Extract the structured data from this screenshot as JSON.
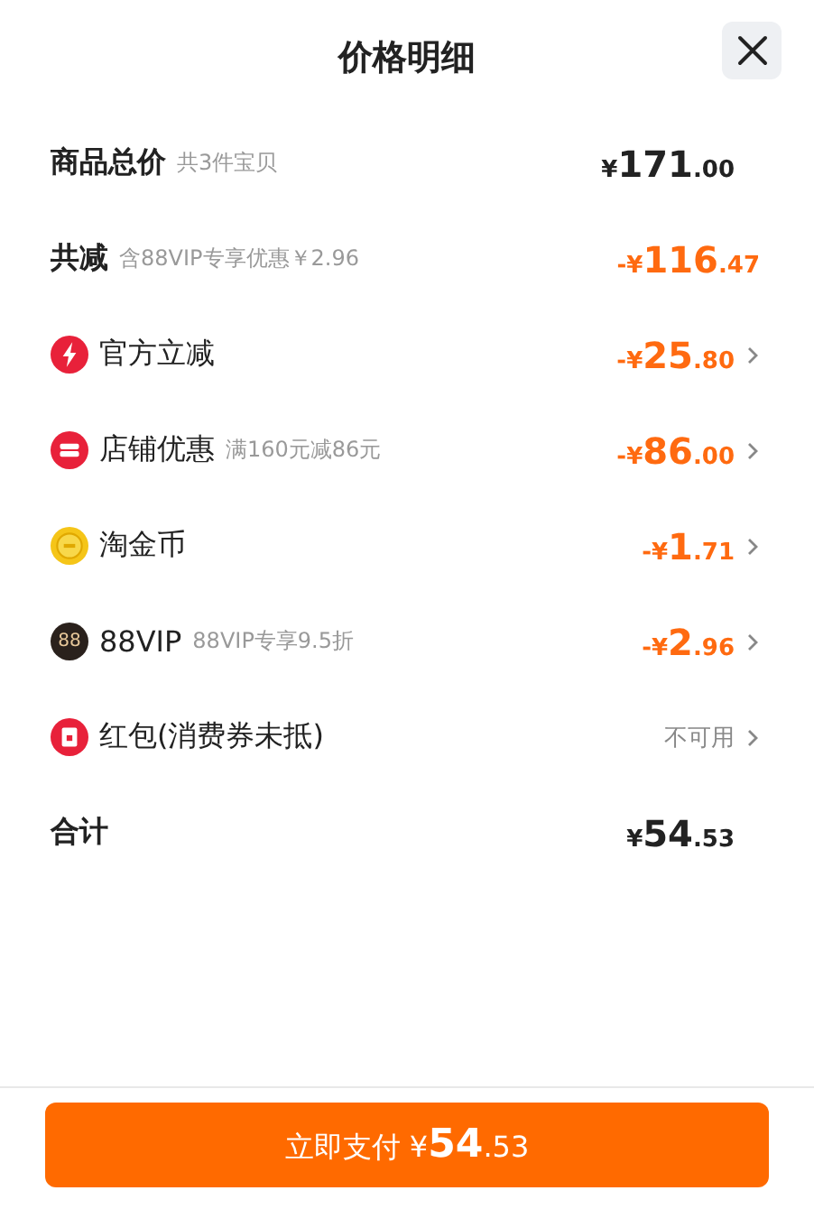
{
  "title": "价格明细",
  "rows": [
    {
      "kind": "total",
      "label": "商品总价",
      "note": "共3件宝贝",
      "amount": {
        "sign": "¥",
        "int": "171",
        "dec": ".00"
      }
    },
    {
      "kind": "discount_total",
      "label": "共减",
      "note": "含88VIP专享优惠￥2.96",
      "amount": {
        "sign": "-¥",
        "int": "116",
        "dec": ".47"
      }
    },
    {
      "kind": "promo",
      "label": "官方立减",
      "amount": {
        "sign": "-¥",
        "int": "25",
        "dec": ".80"
      }
    },
    {
      "kind": "promo",
      "label": "店铺优惠",
      "note": "满160元减86元",
      "amount": {
        "sign": "-¥",
        "int": "86",
        "dec": ".00"
      }
    },
    {
      "kind": "promo",
      "label": "淘金币",
      "amount": {
        "sign": "-¥",
        "int": "1",
        "dec": ".71"
      }
    },
    {
      "kind": "promo",
      "label": "88VIP",
      "icon_text": "88",
      "note": "88VIP专享9.5折",
      "amount": {
        "sign": "-¥",
        "int": "2",
        "dec": ".96"
      }
    },
    {
      "kind": "promo",
      "label": "红包(消费券未抵)",
      "status": "不可用"
    },
    {
      "kind": "total",
      "label": "合计",
      "amount": {
        "sign": "¥",
        "int": "54",
        "dec": ".53"
      }
    }
  ],
  "pay_button": {
    "label": "立即支付",
    "amount": {
      "sign": "¥",
      "int": "54",
      "dec": ".53"
    }
  }
}
